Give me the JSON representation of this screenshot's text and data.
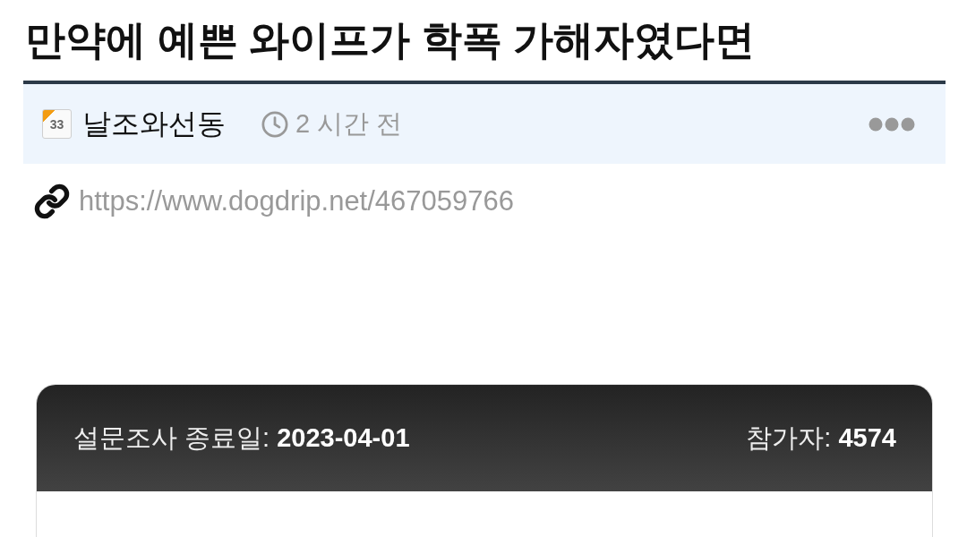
{
  "post": {
    "title": "만약에 예쁜 와이프가 학폭 가해자였다면",
    "author": {
      "level": "33",
      "name": "날조와선동"
    },
    "time": "2 시간 전",
    "url": "https://www.dogdrip.net/467059766"
  },
  "poll": {
    "end_date": "설문조사 종료일: **2023-04-01**",
    "participants": "참가자: **4574**"
  }
}
